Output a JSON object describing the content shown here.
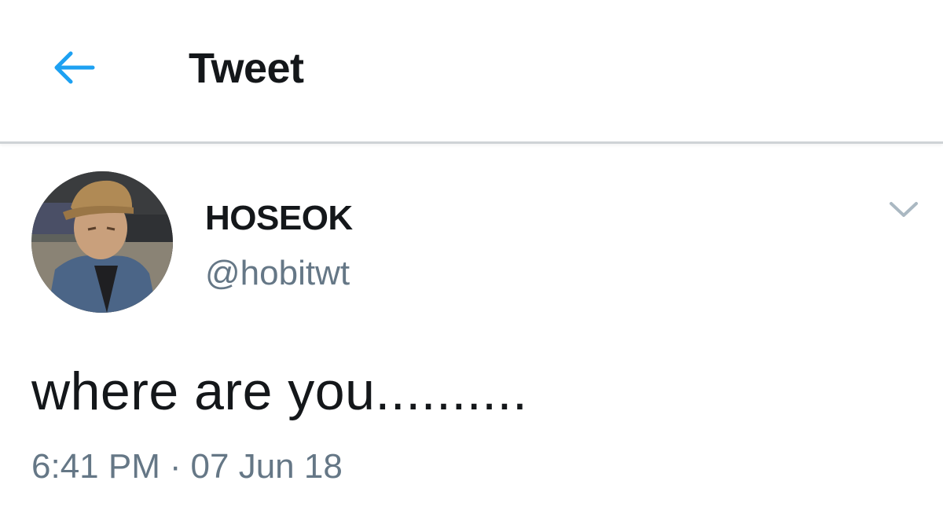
{
  "header": {
    "back_icon": "arrow-left-icon",
    "title": "Tweet"
  },
  "tweet": {
    "author": {
      "display_name": "HOSEOK",
      "handle": "@hobitwt",
      "avatar": "profile-photo"
    },
    "caret_icon": "chevron-down-icon",
    "text": "where are you..........",
    "time": "6:41 PM",
    "separator": "·",
    "date": "07 Jun 18"
  },
  "colors": {
    "accent": "#1da1f2",
    "text_primary": "#14171a",
    "text_secondary": "#657786",
    "divider": "#cfd3d6",
    "caret": "#aab8c2"
  }
}
